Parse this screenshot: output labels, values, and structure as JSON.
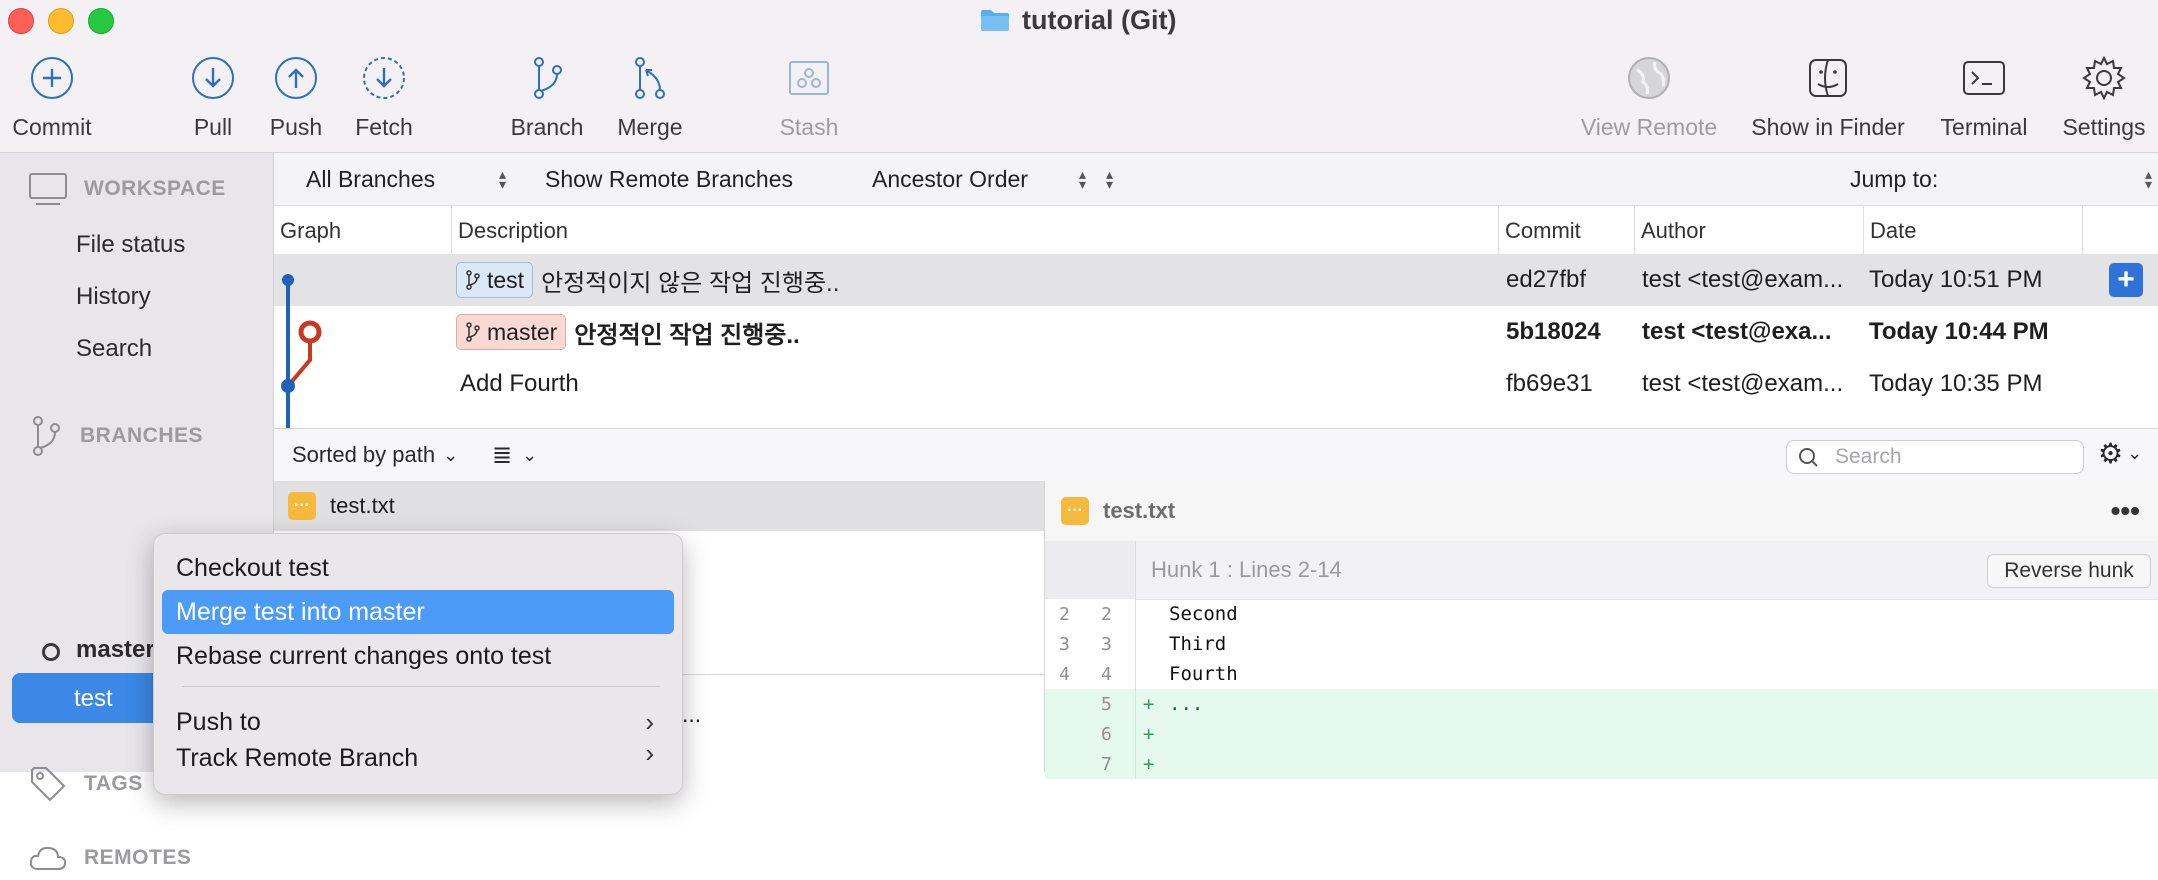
{
  "window": {
    "title": "tutorial (Git)"
  },
  "toolbar": {
    "commit": "Commit",
    "pull": "Pull",
    "push": "Push",
    "fetch": "Fetch",
    "branch": "Branch",
    "merge": "Merge",
    "stash": "Stash",
    "view_remote": "View Remote",
    "show_in_finder": "Show in Finder",
    "terminal": "Terminal",
    "settings": "Settings"
  },
  "sidebar": {
    "workspace_header": "WORKSPACE",
    "workspace_items": [
      "File status",
      "History",
      "Search"
    ],
    "branches_header": "BRANCHES",
    "branches": [
      "master",
      "test"
    ],
    "tags_header": "TAGS",
    "remotes_header": "REMOTES"
  },
  "filters": {
    "branches": "All Branches",
    "remote": "Show Remote Branches",
    "order": "Ancestor Order",
    "jump_to": "Jump to:"
  },
  "table": {
    "headers": {
      "graph": "Graph",
      "description": "Description",
      "commit": "Commit",
      "author": "Author",
      "date": "Date"
    },
    "rows": [
      {
        "branch": "test",
        "message": "안정적이지 않은 작업 진행중..",
        "commit": "ed27fbf",
        "author": "test <test@exam...",
        "date": "Today 10:51 PM"
      },
      {
        "branch": "master",
        "message": "안정적인 작업 진행중..",
        "commit": "5b18024",
        "author": "test <test@exa...",
        "date": "Today 10:44 PM"
      },
      {
        "branch": "",
        "message": "Add Fourth",
        "commit": "fb69e31",
        "author": "test <test@exam...",
        "date": "Today 10:35 PM"
      }
    ]
  },
  "lower": {
    "sort_label": "Sorted by path",
    "search_placeholder": "Search",
    "file_name": "test.txt",
    "partial_text": "..."
  },
  "diff": {
    "file_name": "test.txt",
    "hunk_label": "Hunk 1 : Lines 2-14",
    "reverse_hunk": "Reverse hunk",
    "lines": [
      {
        "old": "2",
        "new": "2",
        "sign": "",
        "text": "Second"
      },
      {
        "old": "3",
        "new": "3",
        "sign": "",
        "text": "Third"
      },
      {
        "old": "4",
        "new": "4",
        "sign": "",
        "text": "Fourth"
      },
      {
        "old": "",
        "new": "5",
        "sign": "+",
        "text": "..."
      },
      {
        "old": "",
        "new": "6",
        "sign": "+",
        "text": ""
      },
      {
        "old": "",
        "new": "7",
        "sign": "+",
        "text": ""
      }
    ]
  },
  "context_menu": {
    "checkout": "Checkout test",
    "merge": "Merge test into master",
    "rebase": "Rebase current changes onto test",
    "push_to": "Push to",
    "track_remote": "Track Remote Branch"
  },
  "colors": {
    "accent": "#3b88e6",
    "graph_blue": "#1f62b8",
    "graph_red": "#c8391f",
    "highlight": "#4c9bf6"
  }
}
